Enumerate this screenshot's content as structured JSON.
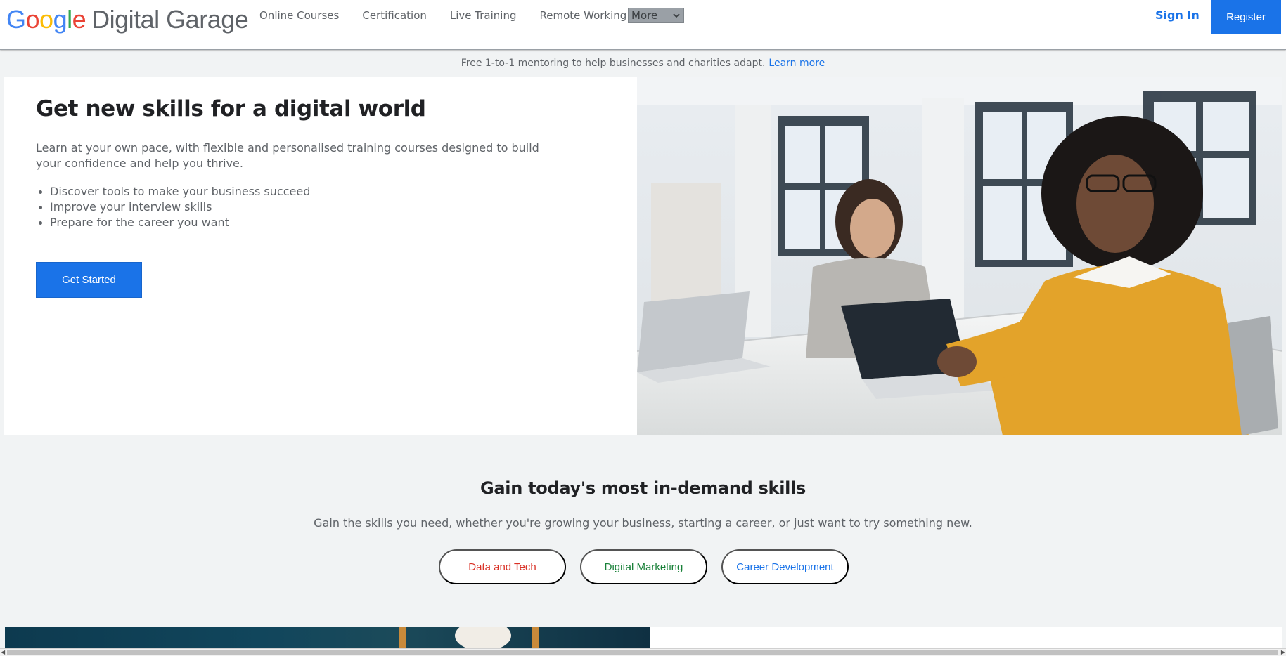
{
  "header": {
    "logo_google": [
      "G",
      "o",
      "o",
      "g",
      "l",
      "e"
    ],
    "logo_text": "Digital Garage",
    "nav": [
      "Online Courses",
      "Certification",
      "Live Training",
      "Remote Working"
    ],
    "more_label": "More",
    "signin_label": "Sign In",
    "register_label": "Register"
  },
  "banner": {
    "text": "Free 1-to-1 mentoring to help businesses and charities adapt.",
    "link": "Learn more"
  },
  "hero": {
    "title": "Get new skills for a digital world",
    "description": "Learn at your own pace, with flexible and personalised training courses designed to build your confidence and help you thrive.",
    "bullets": [
      "Discover tools to make your business succeed",
      "Improve your interview skills",
      "Prepare for the career you want"
    ],
    "cta_label": "Get Started"
  },
  "skills": {
    "title": "Gain today's most in-demand skills",
    "subtitle": "Gain the skills you need, whether you're growing your business, starting a career, or just want to try something new.",
    "chips": [
      "Data and Tech",
      "Digital Marketing",
      "Career Development"
    ]
  },
  "colors": {
    "accent": "#1a73e8",
    "chip_red": "#d93025",
    "chip_green": "#188038",
    "chip_blue": "#1a73e8"
  }
}
